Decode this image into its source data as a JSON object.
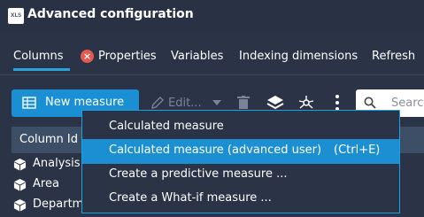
{
  "window": {
    "title": "Advanced configuration",
    "icon_text": "XLS"
  },
  "tabs": [
    {
      "label": "Columns",
      "active": true
    },
    {
      "label": "Properties",
      "status_icon": "error-icon"
    },
    {
      "label": "Variables"
    },
    {
      "label": "Indexing dimensions"
    },
    {
      "label": "Refresh"
    }
  ],
  "toolbar": {
    "new_measure_label": "New measure",
    "edit_label": "Edit...",
    "search_placeholder": "Search"
  },
  "table": {
    "column_header": "Column Id",
    "rows": [
      {
        "label": "Analysis"
      },
      {
        "label": "Area"
      },
      {
        "label": "Department"
      }
    ]
  },
  "menu": {
    "items": [
      {
        "label": "Calculated measure",
        "shortcut": ""
      },
      {
        "label": "Calculated measure (advanced user)",
        "shortcut": "(Ctrl+E)",
        "highlighted": true
      },
      {
        "label": "Create a predictive measure ...",
        "shortcut": ""
      },
      {
        "label": "Create a What-if measure ...",
        "shortcut": ""
      }
    ]
  },
  "colors": {
    "background": "#2b3346",
    "accent": "#1a8fd3",
    "error": "#e45a4f",
    "table_header": "#3d4f66"
  }
}
